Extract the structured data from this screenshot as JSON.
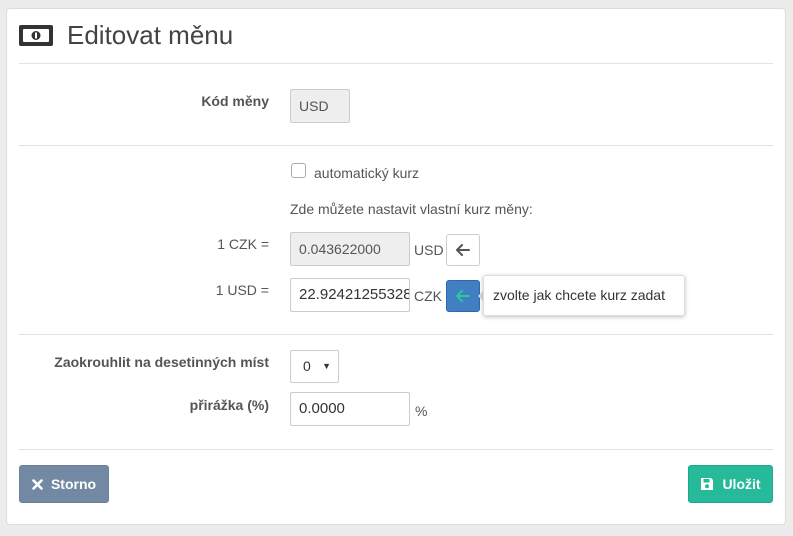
{
  "header": {
    "title": "Editovat měnu",
    "icon": "money-icon"
  },
  "currency_code": {
    "label": "Kód měny",
    "value": "USD"
  },
  "auto_rate": {
    "label": "automatický kurz",
    "checked": false
  },
  "custom_rate_hint": "Zde můžete nastavit vlastní kurz měny:",
  "rate_czk": {
    "label": "1 CZK =",
    "value": "0.043622000",
    "unit": "USD"
  },
  "rate_usd": {
    "label": "1 USD =",
    "value": "22.92421255328",
    "unit": "CZK"
  },
  "tooltip": "zvolte jak chcete kurz zadat",
  "rounding": {
    "label": "Zaokrouhlit na desetinných míst",
    "value": "0"
  },
  "surcharge": {
    "label": "přirážka (%)",
    "value": "0.0000",
    "unit": "%"
  },
  "buttons": {
    "cancel": "Storno",
    "save": "Uložit"
  },
  "colors": {
    "cancel": "#7389a3",
    "save": "#26b99a",
    "active": "#3f7fc2"
  }
}
